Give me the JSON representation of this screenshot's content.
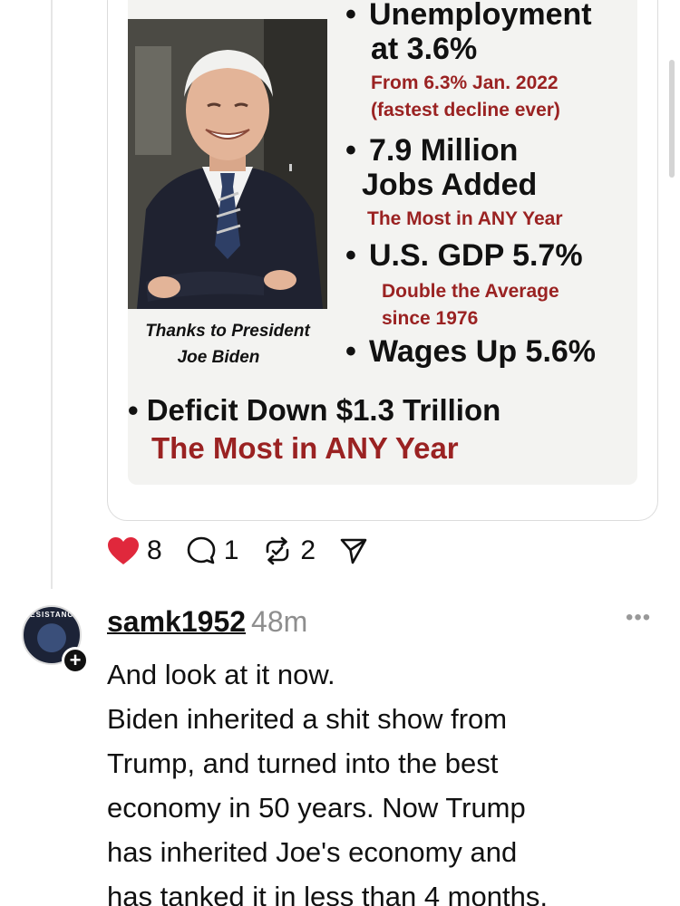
{
  "post_graphic": {
    "caption_line1": "Thanks to President",
    "caption_line2": "Joe Biden",
    "items": [
      {
        "bullet": "•",
        "headline": "Unemployment",
        "headline2": "at 3.6%",
        "detail1": "From 6.3% Jan. 2022",
        "detail2": "(fastest decline ever)"
      },
      {
        "bullet": "•",
        "headline": "7.9 Million",
        "headline2": "Jobs Added",
        "detail1": "The Most in ANY Year"
      },
      {
        "bullet": "•",
        "headline": "U.S. GDP 5.7%",
        "detail1": "Double the Average",
        "detail2": "since 1976"
      },
      {
        "bullet": "•",
        "headline": "Wages Up 5.6%"
      }
    ],
    "wide_headline": "• Deficit Down $1.3 Trillion",
    "wide_detail": "The Most in ANY Year"
  },
  "actions": {
    "likes": "8",
    "comments": "1",
    "reposts": "2",
    "like_color": "#e0283c"
  },
  "reply": {
    "username": "samk1952",
    "time": "48m",
    "more": "•••",
    "avatar_text": "RESISTANCE",
    "follow_symbol": "+",
    "lines": [
      "And look at it now.",
      "Biden inherited a shit show from",
      "Trump, and turned into the best",
      "economy in 50 years. Now Trump",
      "has inherited Joe's economy and",
      "has tanked it in less than 4 months,"
    ]
  }
}
